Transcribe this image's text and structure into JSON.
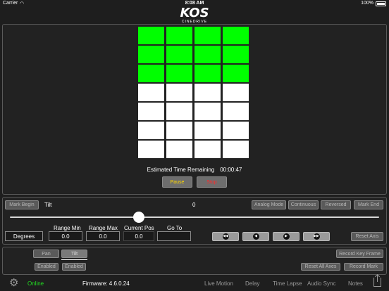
{
  "status_bar": {
    "carrier": "Carrier",
    "time": "8:08 AM",
    "battery": "100%"
  },
  "logo": {
    "brand": "KOS",
    "sub": "CINEDRIVE"
  },
  "grid": {
    "rows": [
      [
        true,
        true,
        true,
        true
      ],
      [
        true,
        true,
        true,
        true
      ],
      [
        true,
        true,
        true,
        true
      ],
      [
        false,
        false,
        false,
        false
      ],
      [
        false,
        false,
        false,
        false
      ],
      [
        false,
        false,
        false,
        false
      ],
      [
        false,
        false,
        false,
        false
      ]
    ]
  },
  "main": {
    "estimated_label": "Estimated Time Remaining",
    "estimated_value": "00:00:47",
    "pause_label": "Pause",
    "stop_label": "Stop"
  },
  "axis": {
    "mark_begin": "Mark Begin",
    "axis_name": "Tilt",
    "position_value": "0",
    "analog_mode": "Analog Mode",
    "continuous": "Continuous",
    "reversed": "Reversed",
    "mark_end": "Mark End",
    "slider_value": 0.35,
    "units": "Degrees",
    "range_min_label": "Range Min",
    "range_min_value": "0.0",
    "range_max_label": "Range Max",
    "range_max_value": "0.0",
    "current_pos_label": "Current Pos",
    "current_pos_value": "0.0",
    "go_to_label": "Go To",
    "go_to_value": "",
    "reset_axis": "Reset Axis"
  },
  "axes_panel": {
    "pan_label": "Pan",
    "tilt_label": "Tilt",
    "pan_enabled": "Enabled",
    "tilt_enabled": "Enabled",
    "record_key_frame": "Record Key Frame",
    "reset_all_axes": "Reset All Axes",
    "record_mark": "Record Mark"
  },
  "bottom": {
    "online": "Online",
    "firmware": "Firmware: 4.6.0.24",
    "tabs": [
      "Live Motion",
      "Delay",
      "Time Lapse",
      "Audio Sync",
      "Notes"
    ]
  },
  "colors": {
    "green": "#00ff00",
    "online": "#22dd22",
    "pause": "#ffd700",
    "stop": "#ff2a2a"
  }
}
